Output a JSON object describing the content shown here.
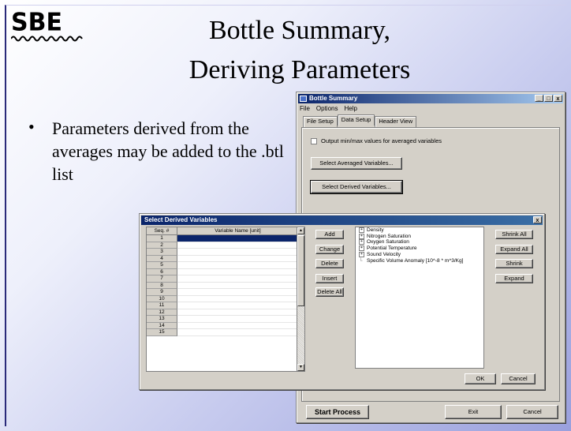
{
  "slide": {
    "logo_text": "SBE",
    "title_line1": "Bottle Summary,",
    "title_line2": "Deriving Parameters",
    "bullet": "Parameters derived from the averages may be added to the .btl list"
  },
  "bottle_window": {
    "title": "Bottle Summary",
    "menu": [
      "File",
      "Options",
      "Help"
    ],
    "tabs": [
      "File Setup",
      "Data Setup",
      "Header View"
    ],
    "active_tab": "Data Setup",
    "checkbox_label": "Output min/max values for averaged variables",
    "select_averaged": "Select Averaged Variables...",
    "select_derived": "Select Derived Variables...",
    "start_process": "Start Process",
    "exit": "Exit",
    "cancel": "Cancel",
    "titlebar_buttons": [
      "_",
      "□",
      "x"
    ]
  },
  "derived_dialog": {
    "title": "Select Derived Variables",
    "close": "x",
    "col_seq": "Seq. #",
    "col_name": "Variable Name [unit]",
    "rows": [
      "1",
      "2",
      "3",
      "4",
      "5",
      "6",
      "7",
      "8",
      "9",
      "10",
      "11",
      "12",
      "13",
      "14",
      "15"
    ],
    "action_buttons": [
      "Add",
      "Change",
      "Delete",
      "Insert",
      "Delete All"
    ],
    "tree_items": [
      {
        "label": "Density",
        "expandable": true
      },
      {
        "label": "Nitrogen Saturation",
        "expandable": true
      },
      {
        "label": "Oxygen Saturation",
        "expandable": true
      },
      {
        "label": "Potential Temperature",
        "expandable": true
      },
      {
        "label": "Sound Velocity",
        "expandable": true
      },
      {
        "label": "Specific Volume Anomaly [10^-8 * m^3/Kg]",
        "expandable": false
      }
    ],
    "tree_buttons": [
      "Shrink All",
      "Expand All",
      "Shrink",
      "Expand"
    ],
    "ok": "OK",
    "cancel": "Cancel"
  }
}
